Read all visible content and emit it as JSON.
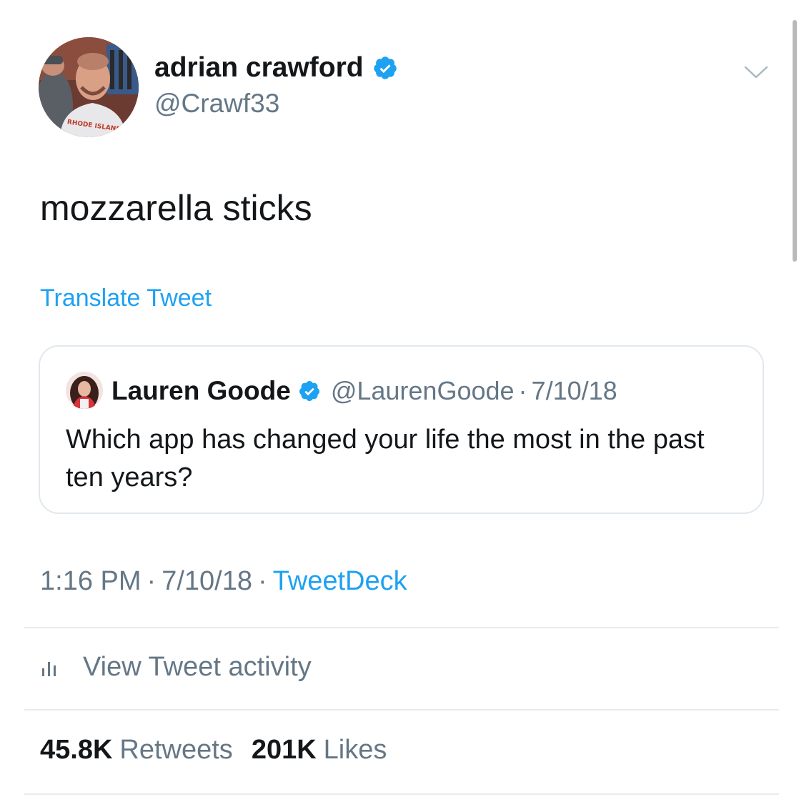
{
  "tweet": {
    "author": {
      "name": "adrian crawford",
      "handle": "@Crawf33",
      "verified": true,
      "avatar_shirt_text": "RHODE ISLAND"
    },
    "text": "mozzarella sticks",
    "translate_label": "Translate Tweet",
    "quoted": {
      "name": "Lauren Goode",
      "handle": "@LaurenGoode",
      "separator": "·",
      "date": "7/10/18",
      "text": "Which app has changed your life the most in the past ten years?",
      "verified": true
    },
    "meta": {
      "time": "1:16 PM",
      "separator": "·",
      "date": "7/10/18",
      "source": "TweetDeck"
    },
    "activity_label": "View Tweet activity",
    "stats": {
      "retweets_count": "45.8K",
      "retweets_label": "Retweets",
      "likes_count": "201K",
      "likes_label": "Likes"
    }
  },
  "colors": {
    "link": "#1da1f2",
    "muted": "#657786",
    "text": "#14171a",
    "border": "#e1e8ed"
  },
  "icons": {
    "verified": "verified-badge-icon",
    "menu": "chevron-down-icon",
    "activity": "bar-chart-icon"
  }
}
